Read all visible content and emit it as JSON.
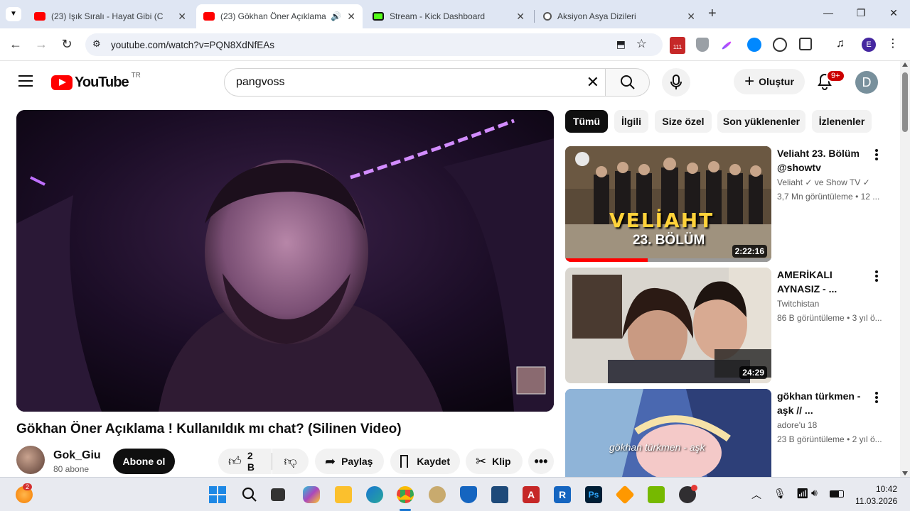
{
  "browser": {
    "tabs": [
      {
        "title": "(23) Işık Sıralı - Hayat Gibi (C",
        "active": false
      },
      {
        "title": "(23) Gökhan Öner Açıklama",
        "active": true
      },
      {
        "title": "Stream - Kick Dashboard",
        "active": false
      },
      {
        "title": "Aksiyon Asya Dizileri",
        "active": false
      }
    ],
    "new_tab": "+",
    "url": "youtube.com/watch?v=PQN8XdNfEAs",
    "ext_badge": "111",
    "profile_initial": "E"
  },
  "youtube": {
    "logo_text": "YouTube",
    "region": "TR",
    "search_value": "pangvoss",
    "create_label": "Oluştur",
    "notif_count": "9+",
    "avatar_initial": "D"
  },
  "video": {
    "title": "Gökhan Öner Açıklama ! Kullanıldık mı chat? (Silinen Video)",
    "channel_name": "Gok_Giu",
    "subscribers": "80 abone",
    "subscribe_label": "Abone ol",
    "likes": "2 B",
    "share_label": "Paylaş",
    "save_label": "Kaydet",
    "clip_label": "Klip"
  },
  "chips": [
    "Tümü",
    "İlgili",
    "Size özel",
    "Son yüklenenler",
    "İzlenenler"
  ],
  "related": [
    {
      "title": "Veliaht 23. Bölüm @showtv",
      "channel": "Veliaht ✓ ve Show TV ✓",
      "meta": "3,7 Mn görüntüleme • 12 ...",
      "duration": "2:22:16",
      "thumb_text": "VELİAHT",
      "thumb_sub": "23. BÖLÜM"
    },
    {
      "title": "AMERİKALI AYNASIZ - ...",
      "channel": "Twitchistan",
      "meta": "86 B görüntüleme • 3 yıl ö...",
      "duration": "24:29"
    },
    {
      "title": "gökhan türkmen - aşk // ...",
      "channel": "adore'u 18",
      "meta": "23 B görüntüleme • 2 yıl ö...",
      "thumb_text": "gökhan türkmen - aşk"
    }
  ],
  "taskbar": {
    "time": "10:42",
    "date": "11.03.2026",
    "weather_badge": "2"
  }
}
